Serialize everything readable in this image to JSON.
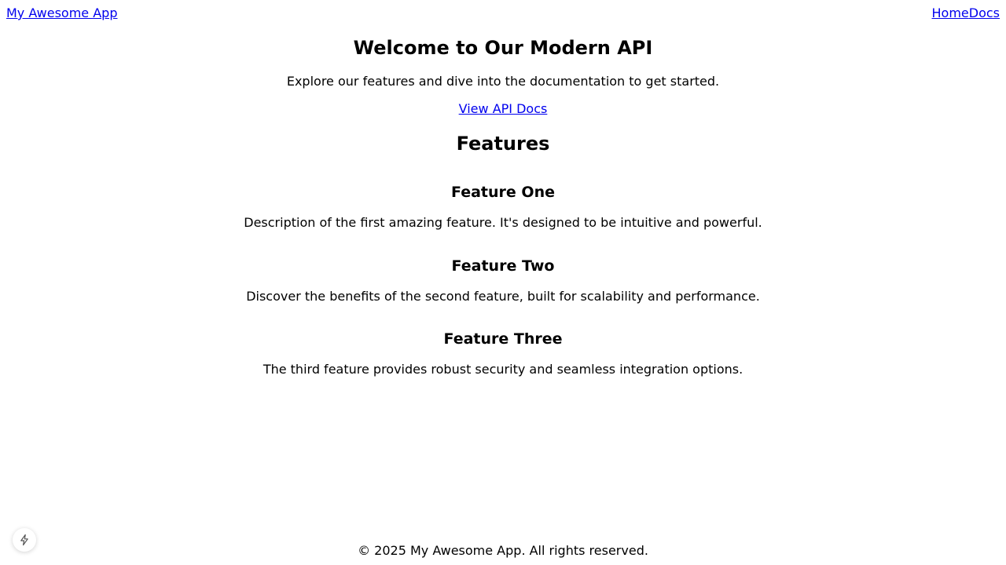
{
  "header": {
    "brand": "My Awesome App",
    "nav": [
      {
        "label": "Home"
      },
      {
        "label": "Docs"
      }
    ]
  },
  "hero": {
    "title": "Welcome to Our Modern API",
    "subtitle": "Explore our features and dive into the documentation to get started.",
    "cta_label": "View API Docs"
  },
  "features": {
    "title": "Features",
    "items": [
      {
        "title": "Feature One",
        "description": "Description of the first amazing feature. It's designed to be intuitive and powerful."
      },
      {
        "title": "Feature Two",
        "description": "Discover the benefits of the second feature, built for scalability and performance."
      },
      {
        "title": "Feature Three",
        "description": "The third feature provides robust security and seamless integration options."
      }
    ]
  },
  "footer": {
    "text": "© 2025 My Awesome App. All rights reserved."
  },
  "devtools": {
    "icon": "lightning-bolt-icon"
  },
  "colors": {
    "link": "#0000ee",
    "text": "#000000",
    "background": "#ffffff"
  }
}
